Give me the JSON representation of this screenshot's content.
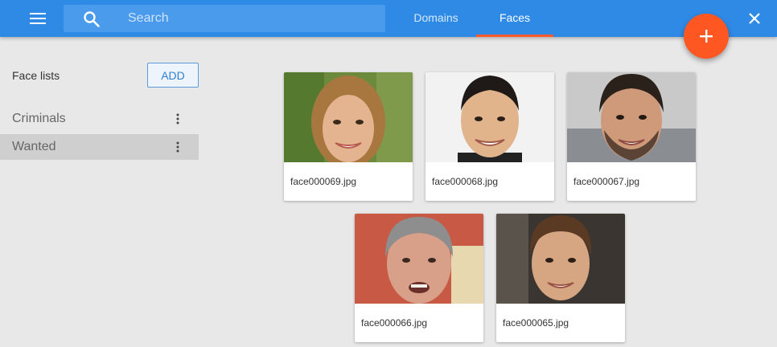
{
  "appbar": {
    "search_placeholder": "Search",
    "tabs": [
      {
        "label": "Domains",
        "active": false
      },
      {
        "label": "Faces",
        "active": true
      }
    ],
    "colors": {
      "bar": "#2f8ae6",
      "accent": "#ff5722"
    }
  },
  "sidebar": {
    "title": "Face lists",
    "add_label": "ADD",
    "items": [
      {
        "label": "Criminals",
        "selected": false
      },
      {
        "label": "Wanted",
        "selected": true
      }
    ]
  },
  "faces": [
    {
      "filename": "face000069.jpg",
      "photo": "woman-smiling-photo"
    },
    {
      "filename": "face000068.jpg",
      "photo": "man-smiling-photo"
    },
    {
      "filename": "face000067.jpg",
      "photo": "bearded-man-photo"
    },
    {
      "filename": "face000066.jpg",
      "photo": "older-man-photo"
    },
    {
      "filename": "face000065.jpg",
      "photo": "young-man-photo"
    }
  ]
}
